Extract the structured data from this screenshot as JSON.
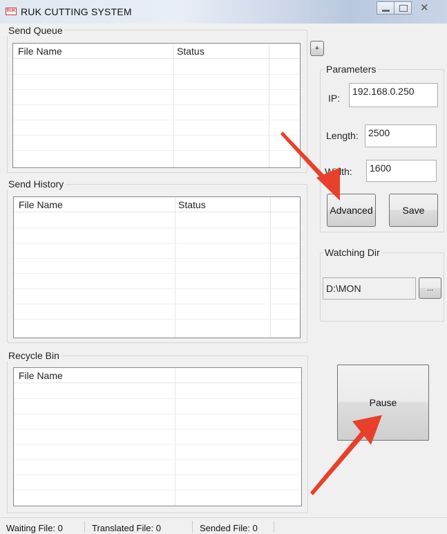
{
  "window": {
    "app_icon_text": "RUK",
    "title": "RUK CUTTING SYSTEM"
  },
  "send_queue": {
    "title": "Send Queue",
    "columns": [
      "File Name",
      "Status"
    ],
    "add_label": "+"
  },
  "send_history": {
    "title": "Send History",
    "columns": [
      "File Name",
      "Status"
    ]
  },
  "recycle_bin": {
    "title": "Recycle Bin",
    "columns": [
      "File Name"
    ]
  },
  "parameters": {
    "title": "Parameters",
    "ip_label": "IP:",
    "ip_value": "192.168.0.250",
    "length_label": "Length:",
    "length_value": "2500",
    "width_label": "Width:",
    "width_value": "1600",
    "advanced_label": "Advanced",
    "save_label": "Save"
  },
  "watching_dir": {
    "title": "Watching Dir",
    "path": "D:\\MON",
    "browse_label": "..."
  },
  "pause_label": "Pause",
  "status_bar": {
    "waiting": "Waiting File: 0",
    "translated": "Translated File: 0",
    "sended": "Sended File: 0"
  },
  "colors": {
    "annotation_arrow": "#e8402a"
  }
}
